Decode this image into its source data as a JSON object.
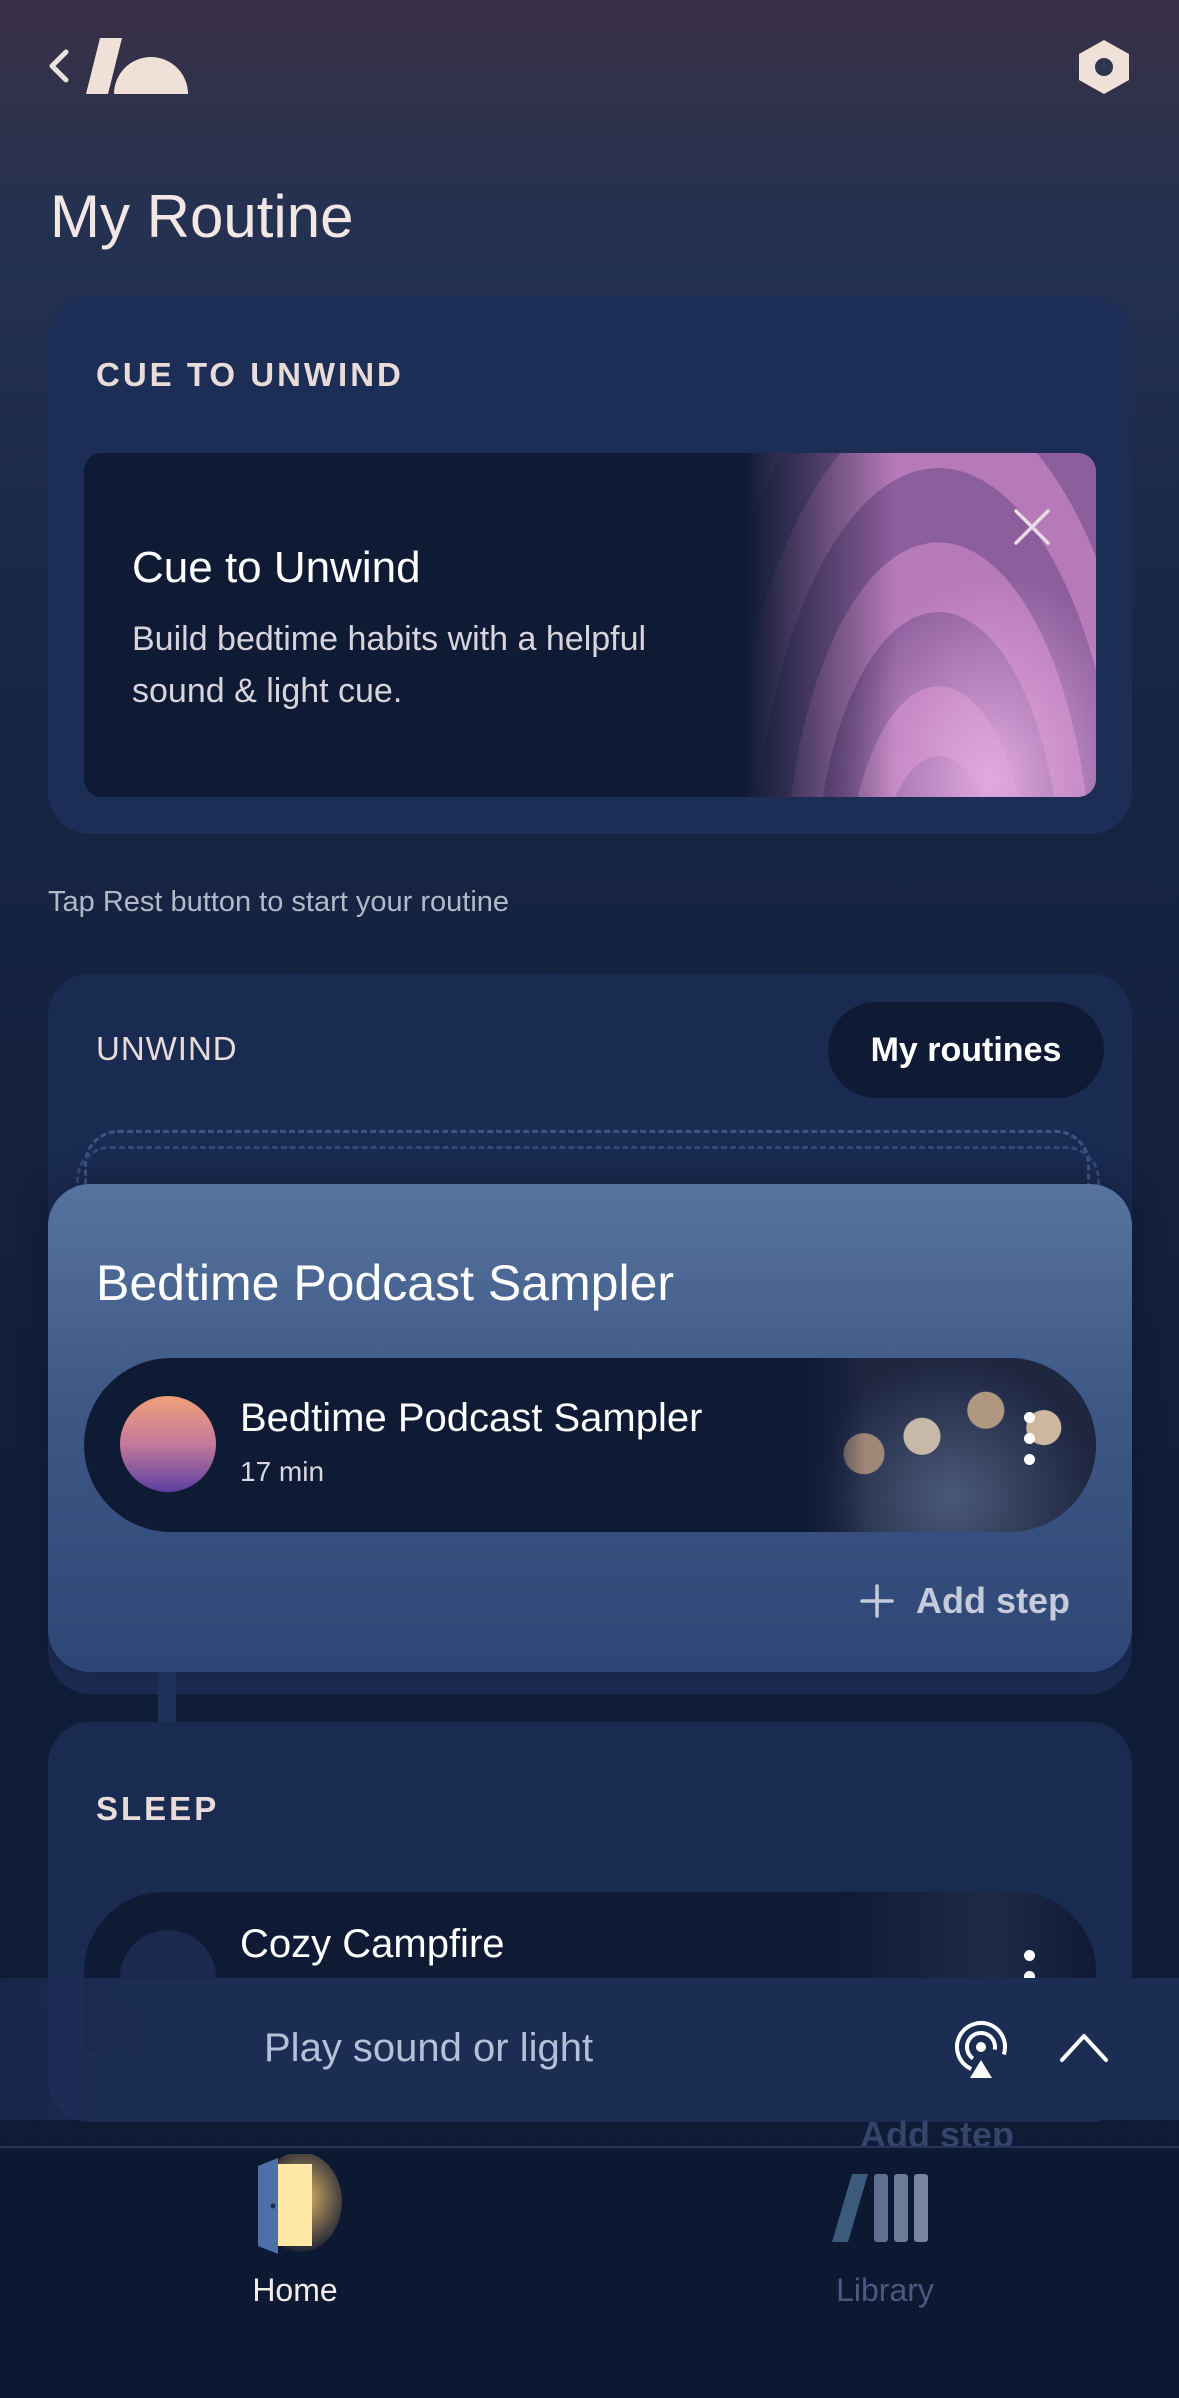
{
  "header": {
    "title": "My Routine"
  },
  "cue_section": {
    "label": "CUE TO UNWIND",
    "card_title": "Cue to Unwind",
    "card_description": "Build bedtime habits with a helpful sound & light cue."
  },
  "hint": "Tap Rest button to start your routine",
  "unwind_section": {
    "label": "UNWIND",
    "routines_button": "My routines",
    "routine_title": "Bedtime Podcast Sampler",
    "step": {
      "title": "Bedtime Podcast Sampler",
      "duration": "17 min"
    },
    "add_step": "Add step"
  },
  "sleep_section": {
    "label": "SLEEP",
    "step": {
      "title": "Cozy Campfire"
    },
    "add_step": "Add step"
  },
  "player": {
    "placeholder": "Play sound or light"
  },
  "nav": {
    "items": [
      {
        "label": "Home",
        "icon": "door-icon",
        "active": true
      },
      {
        "label": "Library",
        "icon": "library-icon",
        "active": false
      }
    ]
  },
  "colors": {
    "background": "#172545",
    "card": "#1a2b52",
    "accent_card": "#4f6a96",
    "text_primary": "#ffffff",
    "text_muted": "#b3b8c8"
  }
}
